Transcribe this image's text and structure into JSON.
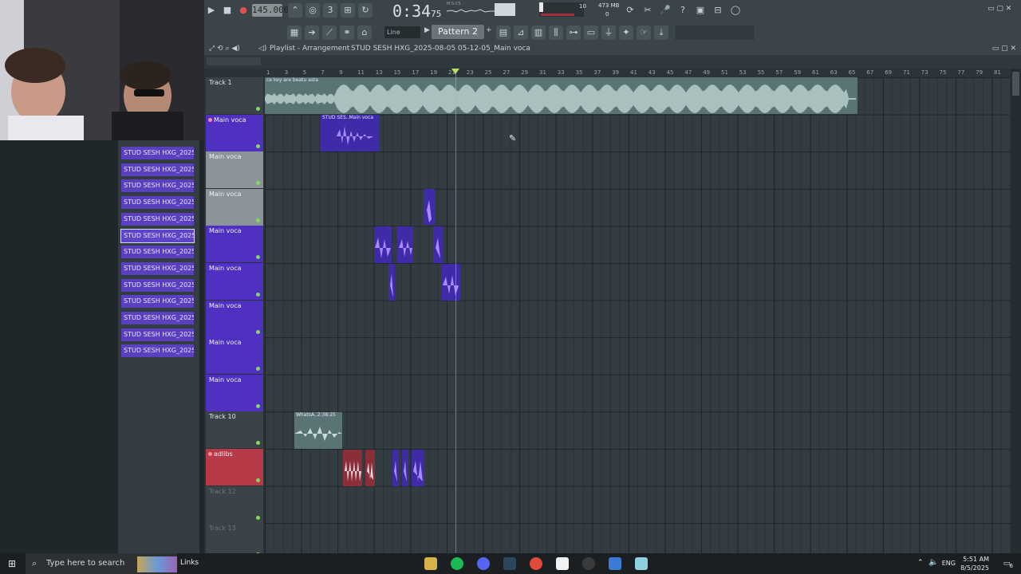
{
  "transport": {
    "tempo": "145.000",
    "time": "0:34",
    "time_sub": "75",
    "time_unit": "M:S:CS",
    "cpu": "10",
    "mem": "473 MB",
    "poly": "0"
  },
  "toolbar2": {
    "snap": "Line",
    "pattern": "Pattern 2"
  },
  "playlist": {
    "title": "Playlist - Arrangement",
    "breadcrumb": "STUD SESH HXG_2025-08-05 05-12-05_Main voca"
  },
  "ruler": [
    "1",
    "3",
    "5",
    "7",
    "9",
    "11",
    "13",
    "15",
    "17",
    "19",
    "21",
    "23",
    "25",
    "27",
    "29",
    "31",
    "33",
    "35",
    "37",
    "39",
    "41",
    "43",
    "45",
    "47",
    "49",
    "51",
    "53",
    "55",
    "57",
    "59",
    "61",
    "63",
    "65",
    "67",
    "69",
    "71",
    "73",
    "75",
    "77",
    "79",
    "81"
  ],
  "tracks": [
    {
      "name": "Track 1",
      "style": "dark-label"
    },
    {
      "name": "Main voca",
      "style": "purple",
      "rec": true
    },
    {
      "name": "Main voca",
      "style": "grey"
    },
    {
      "name": "Main voca",
      "style": "grey"
    },
    {
      "name": "Main voca",
      "style": "purple"
    },
    {
      "name": "Main voca",
      "style": "purple"
    },
    {
      "name": "Main voca",
      "style": "purple"
    },
    {
      "name": "Main voca",
      "style": "purple"
    },
    {
      "name": "Main voca",
      "style": "purple"
    },
    {
      "name": "Track 10",
      "style": "dark-label"
    },
    {
      "name": "adlibs",
      "style": "red",
      "rec": true
    },
    {
      "name": "Track 12",
      "style": "dark"
    },
    {
      "name": "Track 13",
      "style": "dark"
    }
  ],
  "clips": [
    {
      "label": "ce key are beatu asta",
      "color": "teal"
    },
    {
      "label": "STUD SES..Main voca",
      "color": "pur"
    },
    {
      "label": "WhatsA..2:38:25",
      "color": "teal"
    }
  ],
  "browser_items": [
    "STUD SESH HXG_2025-08...",
    "STUD SESH HXG_2025-08...",
    "STUD SESH HXG_2025-08...",
    "STUD SESH HXG_2025-08...",
    "STUD SESH HXG_2025-08...",
    "STUD SESH HXG_2025-08...",
    "STUD SESH HXG_2025-08...",
    "STUD SESH HXG_2025-08...",
    "STUD SESH HXG_2025-08...",
    "STUD SESH HXG_2025-08...",
    "STUD SESH HXG_2025-08...",
    "STUD SESH HXG_2025-08...",
    "STUD SESH HXG_2025-08..."
  ],
  "taskbar": {
    "search_placeholder": "Type here to search",
    "links": "Links",
    "lang": "ENG",
    "time": "5:51 AM",
    "date": "8/5/2025",
    "notif": "6"
  },
  "colors": {
    "track_purple": "#5030c0",
    "track_red": "#b63a48",
    "clip_teal": "#5a7374",
    "clip_purple": "#3f2aa8"
  }
}
